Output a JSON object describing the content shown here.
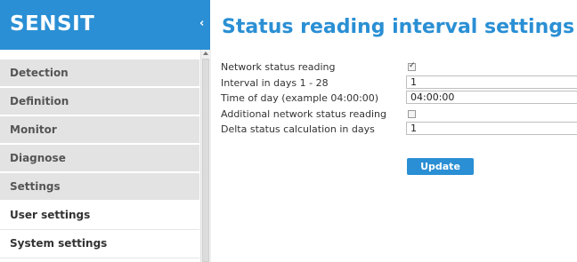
{
  "brand": {
    "logo": "SENSIT",
    "toggle_glyph": "‹"
  },
  "sidebar": {
    "items": [
      {
        "label": "Detection"
      },
      {
        "label": "Definition"
      },
      {
        "label": "Monitor"
      },
      {
        "label": "Diagnose"
      },
      {
        "label": "Settings"
      },
      {
        "label": "User settings"
      },
      {
        "label": "System settings"
      }
    ]
  },
  "page": {
    "title": "Status reading interval settings"
  },
  "form": {
    "network_status_reading": {
      "label": "Network status reading",
      "checked": true
    },
    "interval_days": {
      "label": "Interval in days 1 - 28",
      "value": "1"
    },
    "time_of_day": {
      "label": "Time of day (example 04:00:00)",
      "value": "04:00:00"
    },
    "additional_reading": {
      "label": "Additional network status reading",
      "checked": false
    },
    "delta_days": {
      "label": "Delta status calculation in days",
      "value": "1"
    },
    "update_label": "Update"
  },
  "colors": {
    "accent": "#2a8fd4",
    "nav_background": "#e3e3e3"
  }
}
